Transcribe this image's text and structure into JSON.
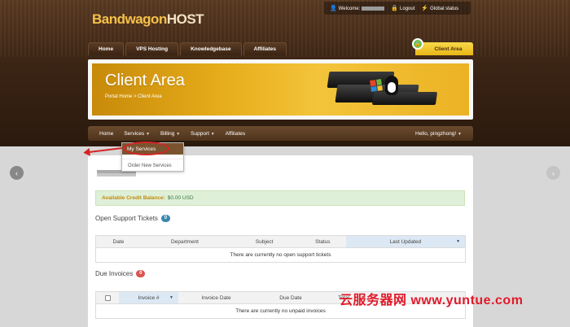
{
  "brand": {
    "part1": "Bandwagon",
    "part2": "HOST"
  },
  "topbar": {
    "welcome": "Welcome:",
    "logout": "Logout",
    "global_status": "Global status"
  },
  "main_nav": [
    "Home",
    "VPS Hosting",
    "Knowledgebase",
    "Affiliates"
  ],
  "client_area_tab": "Client Area",
  "banner": {
    "title": "Client Area",
    "breadcrumb": "Portal Home > Client Area"
  },
  "sub_nav": {
    "home": "Home",
    "services": "Services",
    "billing": "Billing",
    "support": "Support",
    "affiliates": "Affiliates",
    "hello": "Hello, pingzhong!"
  },
  "dropdown": {
    "my_services": "My Services",
    "order_new": "Order New Services"
  },
  "credit": {
    "label": "Available Credit Balance:",
    "value": "$0.00 USD"
  },
  "tickets": {
    "title": "Open Support Tickets",
    "count": "0",
    "columns": [
      "Date",
      "Department",
      "Subject",
      "Status",
      "Last Updated"
    ],
    "empty": "There are currently no open support tickets"
  },
  "invoices": {
    "title": "Due Invoices",
    "count": "0",
    "columns": [
      "Invoice #",
      "Invoice Date",
      "Due Date",
      "Total"
    ],
    "empty": "There are currently no unpaid invoices"
  },
  "watermark": "云服务器网 www.yuntue.com",
  "colors": {
    "accent": "#e9b716",
    "nav_brown": "#4d331c",
    "watermark": "#e01a2a"
  }
}
